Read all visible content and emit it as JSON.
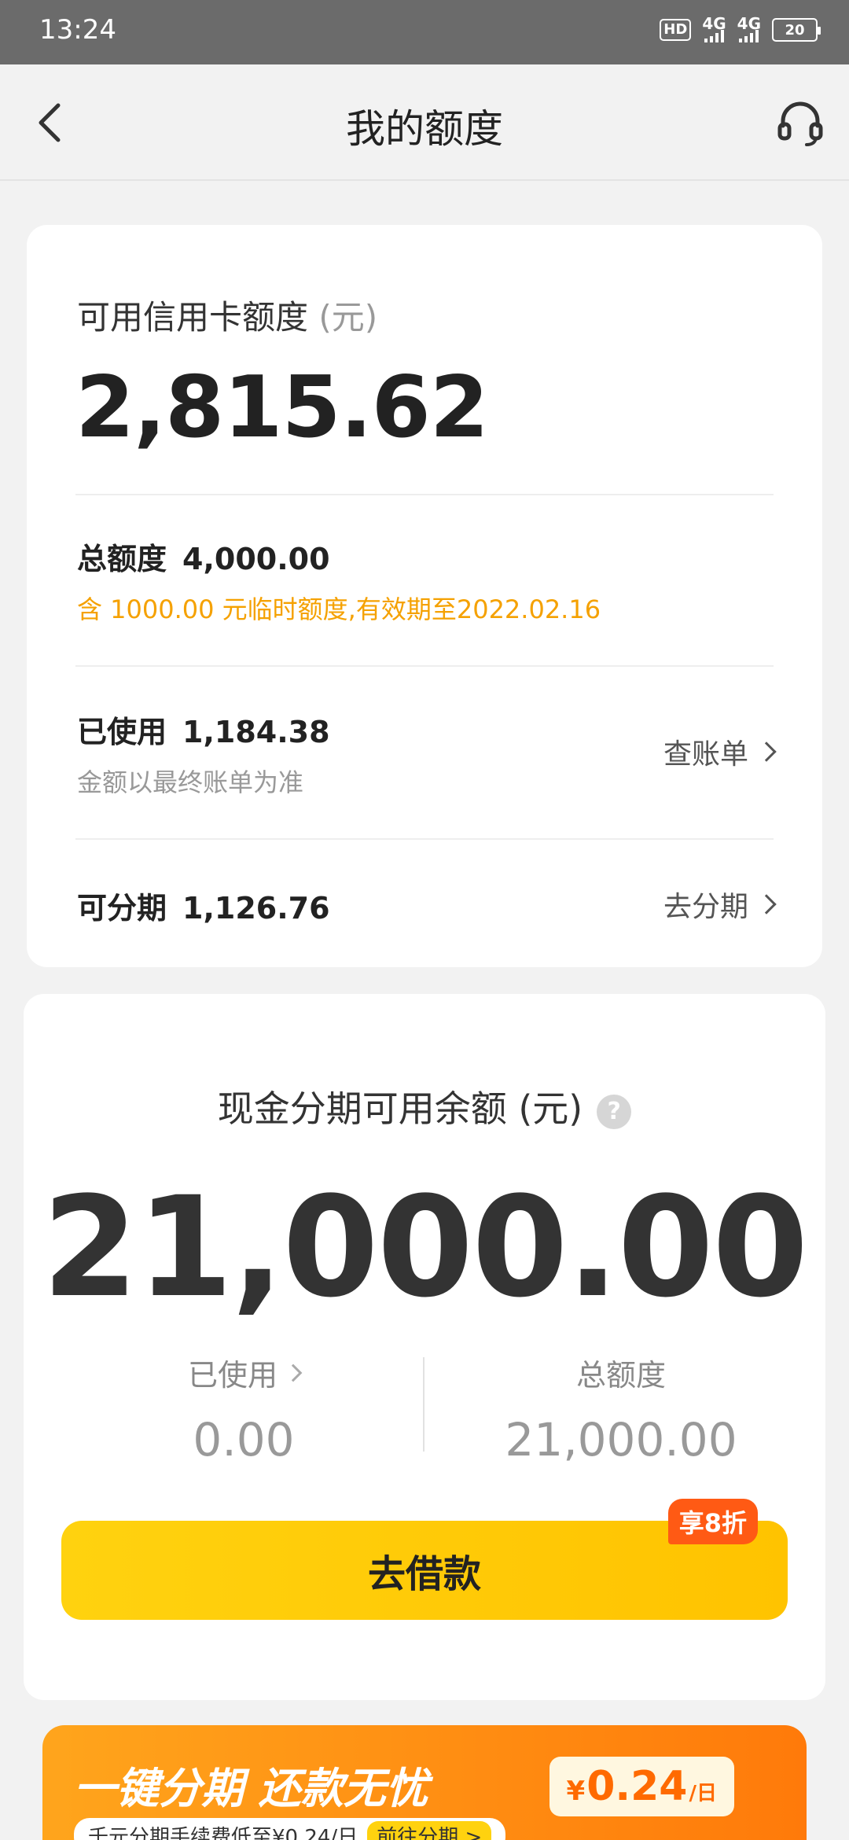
{
  "status_bar": {
    "time": "13:24",
    "hd": "HD",
    "network1": "4G",
    "network2": "4G",
    "battery": "20"
  },
  "nav": {
    "title": "我的额度",
    "back_icon": "chevron-left-icon",
    "service_icon": "headset-icon"
  },
  "credit_card": {
    "available_label": "可用信用卡额度",
    "available_unit": "(元)",
    "available_amount": "2,815.62",
    "total_label": "总额度",
    "total_value": "4,000.00",
    "temp_note": "含 1000.00 元临时额度,有效期至2022.02.16",
    "used_label": "已使用",
    "used_value": "1,184.38",
    "used_note": "金额以最终账单为准",
    "bill_link": "查账单",
    "installment_label": "可分期",
    "installment_value": "1,126.76",
    "installment_link": "去分期"
  },
  "cash": {
    "label": "现金分期可用余额 (元)",
    "help": "?",
    "amount": "21,000.00",
    "used_label": "已使用",
    "used_value": "0.00",
    "total_label": "总额度",
    "total_value": "21,000.00",
    "borrow_button": "去借款",
    "discount_badge": "享8折"
  },
  "promo": {
    "title": "一键分期 还款无忧",
    "subtitle": "千元分期手续费低至¥0.24/日",
    "go_label": "前往分期 >",
    "price_currency": "¥",
    "price_value": "0.24",
    "price_unit": "/日"
  },
  "colors": {
    "accent_yellow": "#ffc300",
    "orange_note": "#f5a100",
    "badge_orange": "#ff5a14",
    "status_bar": "#6b6b6b"
  }
}
